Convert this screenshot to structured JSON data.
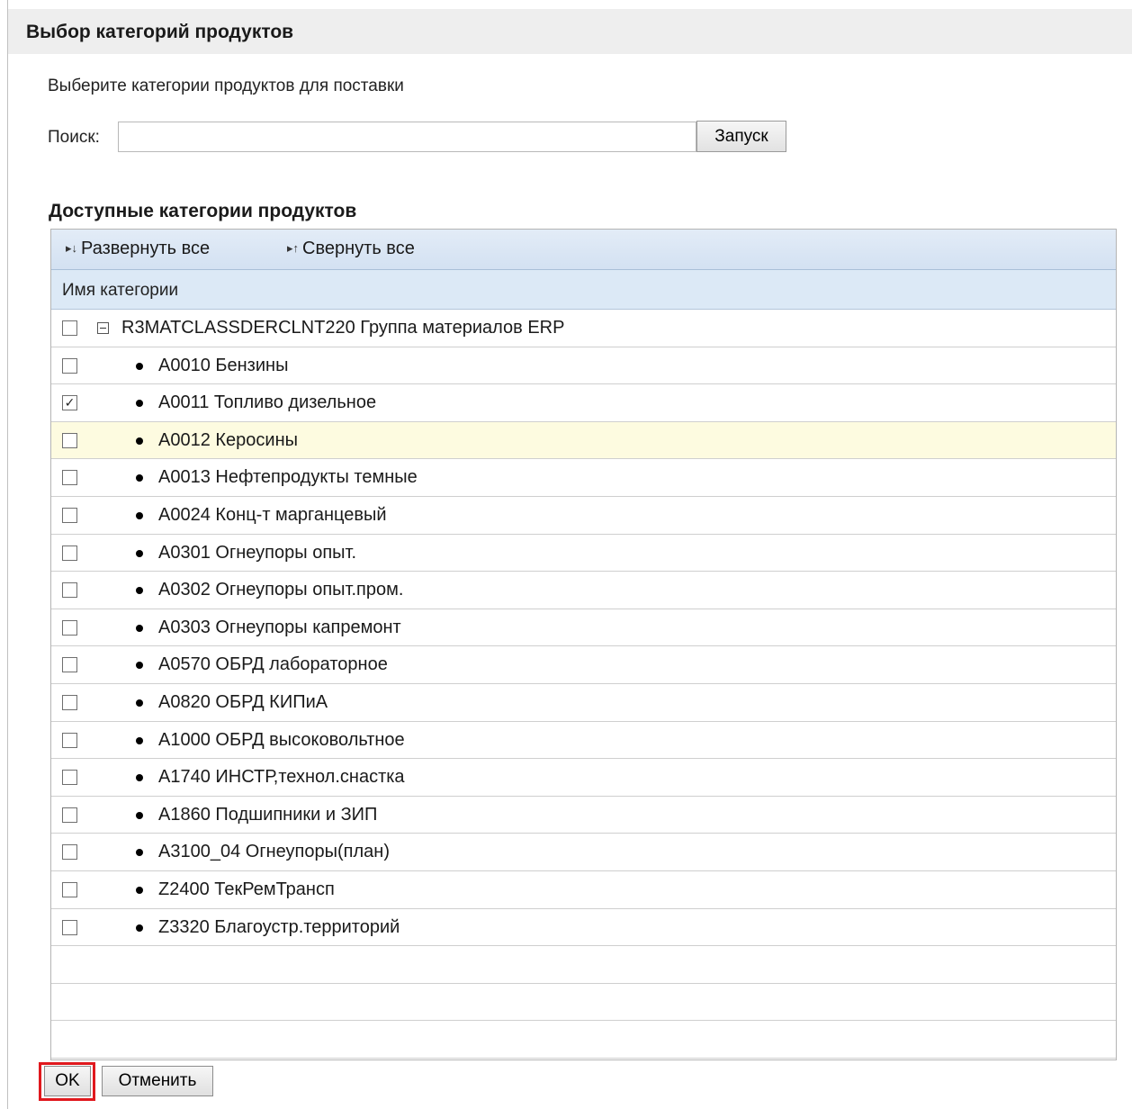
{
  "dialog": {
    "title": "Выбор категорий продуктов",
    "instruction": "Выберите категории продуктов для поставки"
  },
  "search": {
    "label": "Поиск:",
    "value": "",
    "placeholder": "",
    "button_label": "Запуск"
  },
  "section": {
    "title": "Доступные категории продуктов"
  },
  "toolbar": {
    "expand_all": "Развернуть все",
    "collapse_all": "Свернуть все"
  },
  "table": {
    "column_header": "Имя категории",
    "root": {
      "label": "R3MATCLASSDERCLNT220 Группа материалов ERP",
      "checked": false,
      "expanded": true
    },
    "items": [
      {
        "label": "A0010 Бензины",
        "checked": false,
        "highlighted": false
      },
      {
        "label": "A0011 Топливо дизельное",
        "checked": true,
        "highlighted": false
      },
      {
        "label": "A0012 Керосины",
        "checked": false,
        "highlighted": true
      },
      {
        "label": "A0013 Нефтепродукты темные",
        "checked": false,
        "highlighted": false
      },
      {
        "label": "A0024 Конц-т марганцевый",
        "checked": false,
        "highlighted": false
      },
      {
        "label": "A0301 Огнеупоры опыт.",
        "checked": false,
        "highlighted": false
      },
      {
        "label": "A0302 Огнеупоры опыт.пром.",
        "checked": false,
        "highlighted": false
      },
      {
        "label": "A0303 Огнеупоры капремонт",
        "checked": false,
        "highlighted": false
      },
      {
        "label": "A0570 ОБРД лабораторное",
        "checked": false,
        "highlighted": false
      },
      {
        "label": "A0820 ОБРД КИПиА",
        "checked": false,
        "highlighted": false
      },
      {
        "label": "A1000 ОБРД высоковольтное",
        "checked": false,
        "highlighted": false
      },
      {
        "label": "A1740 ИНСТР,технол.снастка",
        "checked": false,
        "highlighted": false
      },
      {
        "label": "A1860 Подшипники и ЗИП",
        "checked": false,
        "highlighted": false
      },
      {
        "label": "A3100_04 Огнеупоры(план)",
        "checked": false,
        "highlighted": false
      },
      {
        "label": "Z2400 ТекРемТрансп",
        "checked": false,
        "highlighted": false
      },
      {
        "label": "Z3320 Благоустр.территорий",
        "checked": false,
        "highlighted": false
      }
    ]
  },
  "footer": {
    "ok_label": "OK",
    "cancel_label": "Отменить"
  },
  "colors": {
    "toolbar_bg": "#d3e1f2",
    "header_bg": "#dce9f6",
    "highlight_row": "#fdfbe0",
    "ok_outline": "#e0191e"
  }
}
